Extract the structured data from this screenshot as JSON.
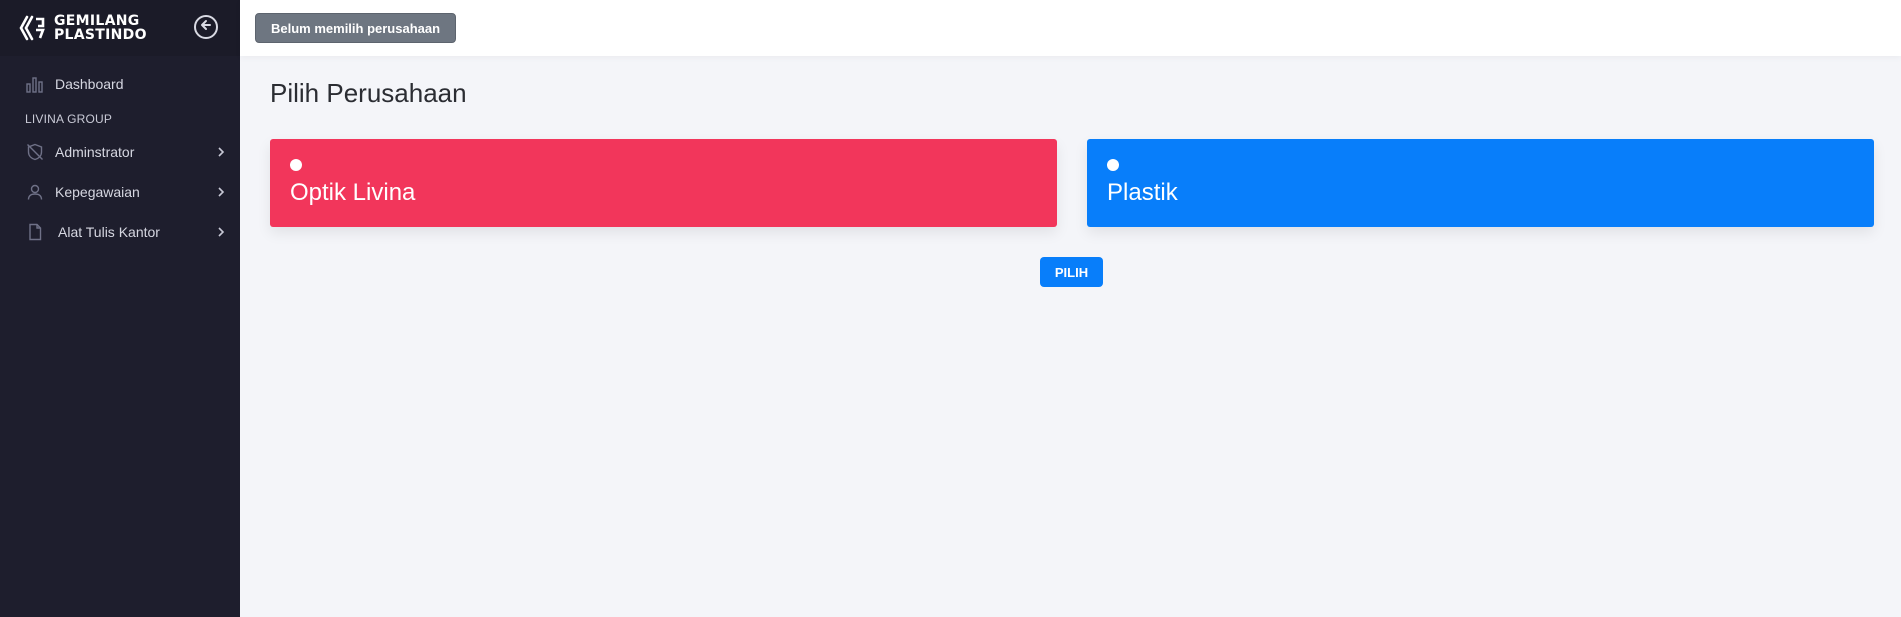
{
  "brand": {
    "line1": "GEMILANG",
    "line2": "PLASTINDO",
    "logo_icon": "gemilang-logo-icon",
    "collapse_icon": "arrow-left-circle-icon"
  },
  "sidebar": {
    "items_top": [
      {
        "label": "Dashboard",
        "icon": "bar-chart-icon"
      }
    ],
    "section_title": "LIVINA GROUP",
    "items": [
      {
        "label": "Adminstrator",
        "icon": "shield-off-icon"
      },
      {
        "label": "Kepegawaian",
        "icon": "user-icon"
      },
      {
        "label": "Alat Tulis Kantor",
        "icon": "file-icon"
      }
    ]
  },
  "topbar": {
    "company_button": "Belum memilih perusahaan"
  },
  "main": {
    "title": "Pilih Perusahaan",
    "companies": [
      {
        "label": "Optik Livina",
        "color": "#f2365b"
      },
      {
        "label": "Plastik",
        "color": "#087efa"
      }
    ],
    "submit_label": "PILIH"
  },
  "colors": {
    "sidebar_bg": "#1e1e2d",
    "accent_blue": "#087efa",
    "accent_red": "#f2365b",
    "page_bg": "#f4f5f9"
  }
}
